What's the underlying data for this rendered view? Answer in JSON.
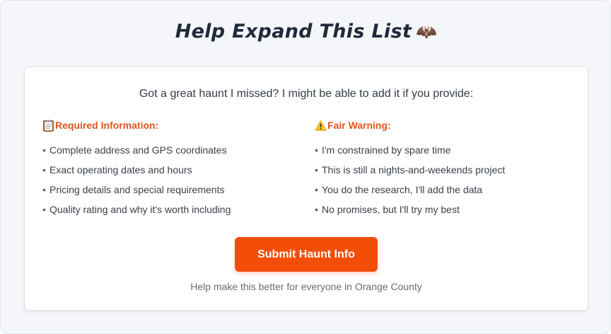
{
  "header": {
    "title": "Help Expand This List",
    "title_emoji": "🦇"
  },
  "intro": "Got a great haunt I missed? I might be able to add it if you provide:",
  "required": {
    "heading": "Required Information:",
    "icon": "clipboard-icon",
    "items": [
      "Complete address and GPS coordinates",
      "Exact operating dates and hours",
      "Pricing details and special requirements",
      "Quality rating and why it's worth including"
    ]
  },
  "warning": {
    "heading": "Fair Warning:",
    "icon": "warning-icon",
    "items": [
      "I'm constrained by spare time",
      "This is still a nights-and-weekends project",
      "You do the research, I'll add the data",
      "No promises, but I'll try my best"
    ]
  },
  "submit": {
    "label": "Submit Haunt Info"
  },
  "footer": "Help make this better for everyone in Orange County",
  "colors": {
    "accent": "#f24e08",
    "heading": "#e0551b",
    "title": "#1f2a3a"
  }
}
